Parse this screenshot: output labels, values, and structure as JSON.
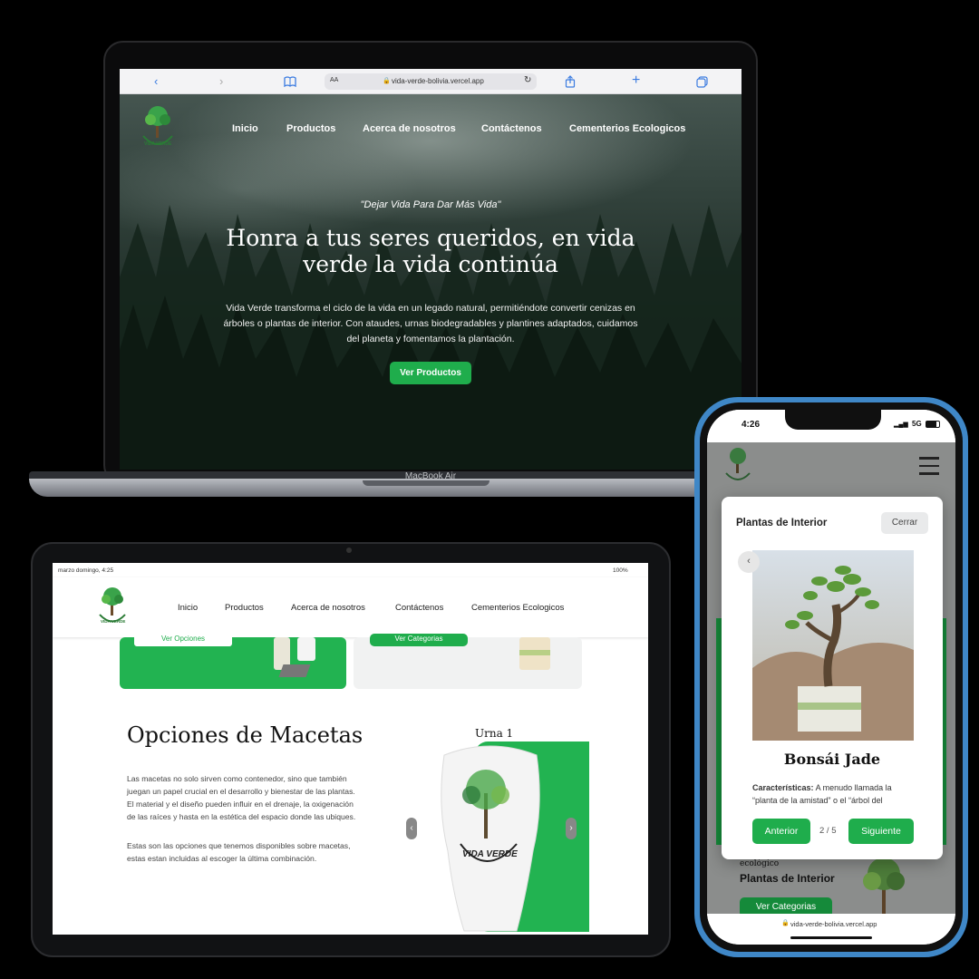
{
  "laptop": {
    "device_label": "MacBook Air",
    "browser": {
      "text_size_label": "AA",
      "url": "vida-verde-bolivia.vercel.app"
    },
    "nav": [
      "Inicio",
      "Productos",
      "Acerca de nosotros",
      "Contáctenos",
      "Cementerios Ecologicos"
    ],
    "logo_text": "VIDA VERDE",
    "hero": {
      "tagline": "\"Dejar Vida Para Dar Más Vida\"",
      "title_line1": "Honra a tus seres queridos, en vida",
      "title_line2": "verde la vida continúa",
      "body_line1": "Vida Verde transforma el ciclo de la vida en un legado natural, permitiéndote convertir cenizas en",
      "body_line2": "árboles o plantas de interior. Con ataudes, urnas biodegradables y plantines adaptados, cuidamos",
      "body_line3": "del planeta y fomentamos la plantación.",
      "cta": "Ver Productos"
    }
  },
  "tablet": {
    "status_time": "marzo domingo, 4:25",
    "battery": "100%",
    "nav": [
      "Inicio",
      "Productos",
      "Acerca de nosotros",
      "Contáctenos",
      "Cementerios Ecologicos"
    ],
    "logo_text": "VIDA VERDE",
    "card1_button": "Ver Opciones",
    "card2_button": "Ver Categorias",
    "section_title": "Opciones de Macetas",
    "para1_line1": "Las macetas no solo sirven como contenedor, sino que también",
    "para1_line2": "juegan un papel crucial en el desarrollo y bienestar de las plantas.",
    "para1_line3": "El material y el diseño pueden influir en el drenaje, la oxigenación",
    "para1_line4": "de las raíces y hasta en la estética del espacio donde las ubiques.",
    "para2_line1": "Estas son las opciones que tenemos disponibles sobre macetas,",
    "para2_line2": "estas estan incluidas al escoger la última combinación.",
    "carousel_title": "Urna 1",
    "urn_logo_text": "VIDA VERDE"
  },
  "phone": {
    "time": "4:26",
    "network": "5G",
    "modal": {
      "title": "Plantas de Interior",
      "close": "Cerrar",
      "product_name": "Bonsái Jade",
      "features_label": "Características:",
      "features_text1": "A menudo llamada la",
      "features_text2": "“planta de la amistad” o el “árbol del",
      "prev": "Anterior",
      "pager": "2 / 5",
      "next": "Siguiente"
    },
    "background": {
      "small_label": "ecológico",
      "heading": "Plantas de Interior",
      "button": "Ver Categorias"
    },
    "url": "vida-verde-bolivia.vercel.app"
  },
  "colors": {
    "brand_green": "#1fad4c",
    "phone_frame": "#3f87c7"
  }
}
